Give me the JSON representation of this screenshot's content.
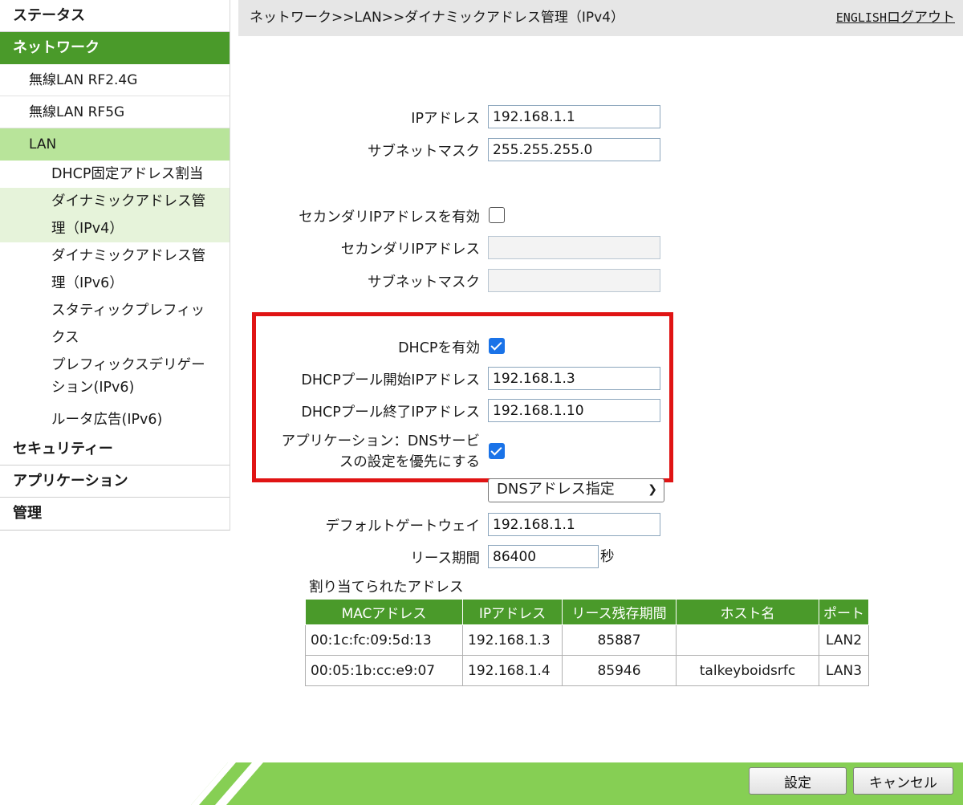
{
  "sidebar": {
    "status": "ステータス",
    "network": "ネットワーク",
    "wlan24": "無線LAN RF2.4G",
    "wlan5": "無線LAN RF5G",
    "lan": "LAN",
    "lan_items": {
      "dhcp_fixed": "DHCP固定アドレス割当",
      "dyn_ipv4_1": "ダイナミックアドレス管",
      "dyn_ipv4_2": "理（IPv4）",
      "dyn_ipv6_1": "ダイナミックアドレス管",
      "dyn_ipv6_2": "理（IPv6）",
      "static_prefix_1": "スタティックプレフィッ",
      "static_prefix_2": "クス",
      "prefix_deleg_1": "プレフィックスデリゲー",
      "prefix_deleg_2": "ション(IPv6)",
      "router_adv": "ルータ広告(IPv6)"
    },
    "security": "セキュリティー",
    "application": "アプリケーション",
    "admin": "管理"
  },
  "header": {
    "breadcrumb": "ネットワーク>>LAN>>ダイナミックアドレス管理（IPv4）",
    "english": "ENGLISH",
    "logout": "ログアウト"
  },
  "form": {
    "ip_label": "IPアドレス",
    "ip_value": "192.168.1.1",
    "mask_label": "サブネットマスク",
    "mask_value": "255.255.255.0",
    "secondary_enable_label": "セカンダリIPアドレスを有効",
    "secondary_enable_checked": false,
    "secondary_ip_label": "セカンダリIPアドレス",
    "secondary_ip_value": "",
    "secondary_mask_label": "サブネットマスク",
    "secondary_mask_value": "",
    "dhcp_enable_label": "DHCPを有効",
    "dhcp_enable_checked": true,
    "pool_start_label": "DHCPプール開始IPアドレス",
    "pool_start_value": "192.168.1.3",
    "pool_end_label": "DHCPプール終了IPアドレス",
    "pool_end_value": "192.168.1.10",
    "dns_priority_label_1": "アプリケーション：DNSサービ",
    "dns_priority_label_2": "スの設定を優先にする",
    "dns_priority_checked": true,
    "dns_select_value": "DNSアドレス指定",
    "gateway_label": "デフォルトゲートウェイ",
    "gateway_value": "192.168.1.1",
    "lease_label": "リース期間",
    "lease_value": "86400",
    "lease_unit": "秒"
  },
  "assigned": {
    "title": "割り当てられたアドレス",
    "headers": [
      "MACアドレス",
      "IPアドレス",
      "リース残存期間",
      "ホスト名",
      "ポート"
    ],
    "rows": [
      [
        "00:1c:fc:09:5d:13",
        "192.168.1.3",
        "85887",
        "",
        "LAN2"
      ],
      [
        "00:05:1b:cc:e9:07",
        "192.168.1.4",
        "85946",
        "talkeyboidsrfc",
        "LAN3"
      ]
    ]
  },
  "footer": {
    "apply": "設定",
    "cancel": "キャンセル"
  },
  "colors": {
    "nav_active": "#4a9a2a",
    "lan_highlight": "#b8e49a",
    "footer_bar": "#86cf54",
    "highlight_box": "#e01414",
    "checkbox": "#1a73e8"
  }
}
